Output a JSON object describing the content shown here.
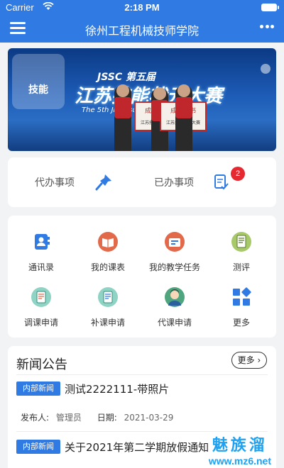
{
  "status_bar": {
    "carrier": "Carrier",
    "time": "2:18 PM"
  },
  "nav": {
    "title": "徐州工程机械技师学院"
  },
  "banner": {
    "brand_text": "技能",
    "subtitle": "JSSC 第五届",
    "title": "江苏技能状元大赛",
    "english": "The 5th Jiangsu Skills Competition",
    "certificate": "成绩证书",
    "certificate_sub": "江苏技能状元大赛"
  },
  "todo": {
    "pending_label": "代办事项",
    "done_label": "已办事项",
    "done_badge": "2"
  },
  "grid": {
    "items": [
      {
        "label": "通讯录"
      },
      {
        "label": "我的课表"
      },
      {
        "label": "我的教学任务"
      },
      {
        "label": "测评"
      },
      {
        "label": "调课申请"
      },
      {
        "label": "补课申请"
      },
      {
        "label": "代课申请"
      },
      {
        "label": "更多"
      }
    ]
  },
  "news": {
    "title": "新闻公告",
    "more_label": "更多",
    "items": [
      {
        "tag": "内部新闻",
        "title": "测试2222111-带照片",
        "publisher_label": "发布人:",
        "publisher": "管理员",
        "date_label": "日期:",
        "date": "2021-03-29"
      },
      {
        "tag": "内部新闻",
        "title": "关于2021年第二学期放假通知"
      }
    ]
  },
  "watermark": {
    "name": "魅族溜",
    "url": "www.mz6.net"
  },
  "colors": {
    "primary": "#2f7be3",
    "badge": "#e62830",
    "background": "#f2f3f5"
  }
}
